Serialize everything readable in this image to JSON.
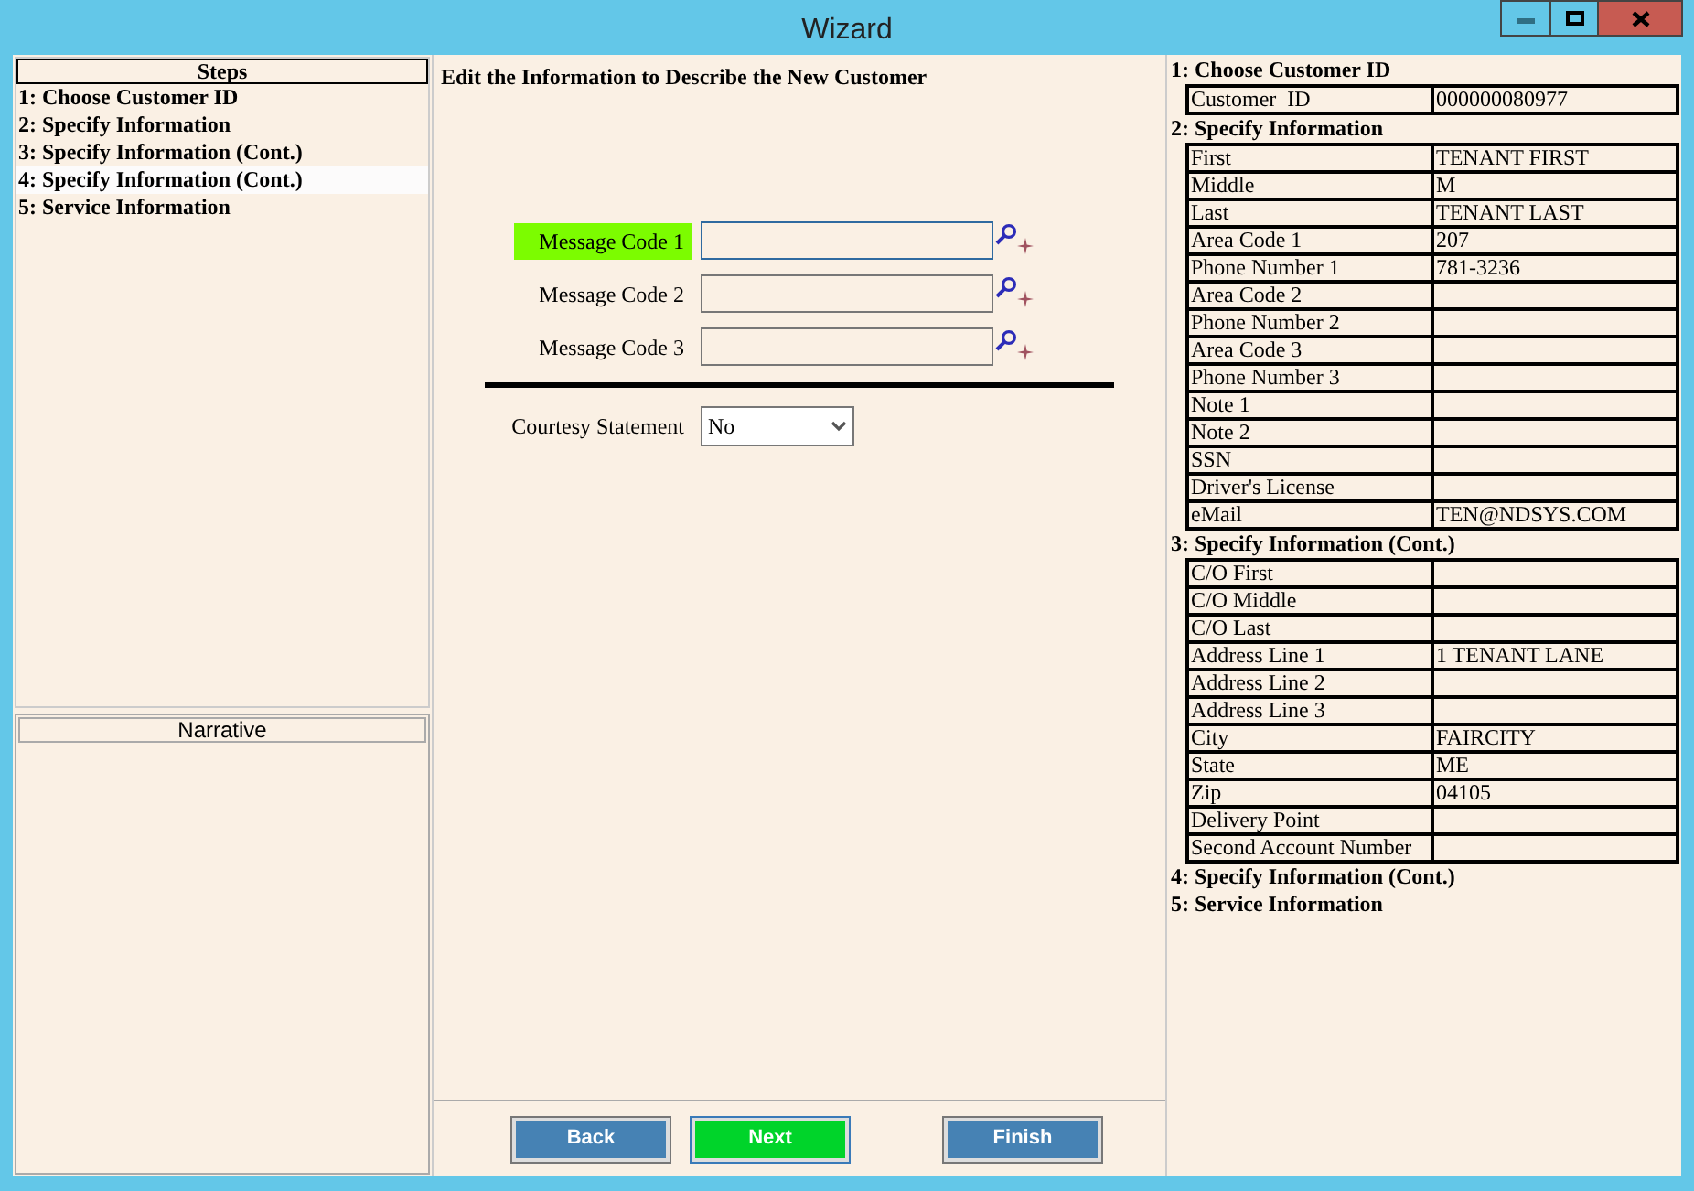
{
  "window": {
    "title": "Wizard",
    "controls": [
      {
        "kind": "minimize"
      },
      {
        "kind": "maximize"
      },
      {
        "kind": "close"
      }
    ]
  },
  "steps": {
    "title": "Steps",
    "items": [
      {
        "label": "1: Choose Customer ID",
        "selected": false
      },
      {
        "label": "2: Specify Information",
        "selected": false
      },
      {
        "label": "3: Specify Information (Cont.)",
        "selected": false
      },
      {
        "label": "4: Specify Information (Cont.)",
        "selected": true
      },
      {
        "label": "5: Service Information",
        "selected": false
      }
    ]
  },
  "narrative": {
    "title": "Narrative"
  },
  "form": {
    "heading": "Edit the Information to Describe the New Customer",
    "fields": [
      {
        "label": "Message Code 1",
        "focused": true
      },
      {
        "label": "Message Code 2",
        "focused": false
      },
      {
        "label": "Message Code 3",
        "focused": false
      }
    ],
    "courtesy": {
      "label": "Courtesy Statement",
      "value": "No"
    }
  },
  "buttons": [
    {
      "label": "Back",
      "primary": false
    },
    {
      "label": "Next",
      "primary": true
    },
    {
      "label": "Finish",
      "primary": false
    }
  ],
  "summary": [
    {
      "title": "1: Choose Customer ID",
      "rows": [
        [
          "Customer  ID",
          "000000080977"
        ]
      ]
    },
    {
      "title": "2: Specify Information",
      "rows": [
        [
          "First",
          "TENANT FIRST"
        ],
        [
          "Middle",
          "M"
        ],
        [
          "Last",
          "TENANT LAST"
        ],
        [
          "Area Code 1",
          "207"
        ],
        [
          "Phone Number 1",
          "781-3236"
        ],
        [
          "Area Code 2",
          ""
        ],
        [
          "Phone Number 2",
          ""
        ],
        [
          "Area Code 3",
          ""
        ],
        [
          "Phone Number 3",
          ""
        ],
        [
          "Note 1",
          ""
        ],
        [
          "Note 2",
          ""
        ],
        [
          "SSN",
          ""
        ],
        [
          "Driver's License",
          ""
        ],
        [
          "eMail",
          "TEN@NDSYS.COM"
        ]
      ]
    },
    {
      "title": "3: Specify Information (Cont.)",
      "rows": [
        [
          "C/O First",
          ""
        ],
        [
          "C/O Middle",
          ""
        ],
        [
          "C/O Last",
          ""
        ],
        [
          "Address Line 1",
          "1 TENANT LANE"
        ],
        [
          "Address Line 2",
          ""
        ],
        [
          "Address Line 3",
          ""
        ],
        [
          "City",
          "FAIRCITY"
        ],
        [
          "State",
          "ME"
        ],
        [
          "Zip",
          "04105"
        ],
        [
          "Delivery Point",
          ""
        ],
        [
          "Second Account Number",
          ""
        ]
      ]
    },
    {
      "title": "4: Specify Information (Cont.)"
    },
    {
      "title": "5: Service Information"
    }
  ]
}
